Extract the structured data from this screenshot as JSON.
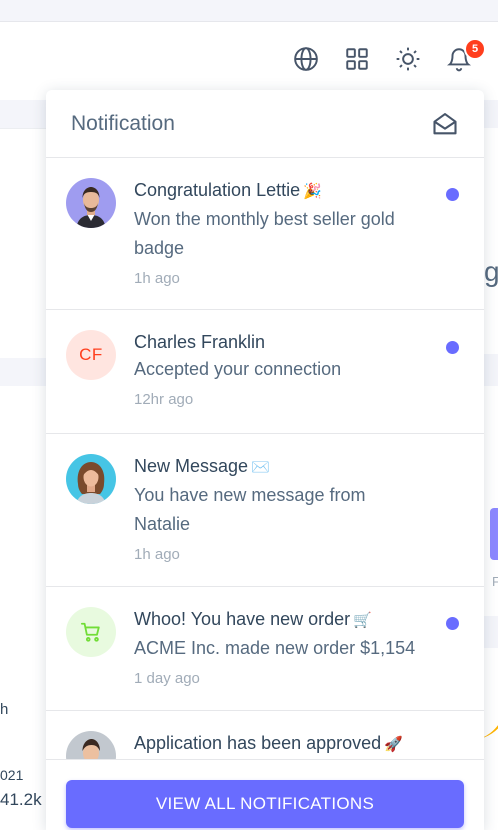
{
  "navbar": {
    "icons": [
      "globe-icon",
      "grid-icon",
      "sun-icon",
      "bell-icon"
    ],
    "notification_count": "5"
  },
  "background": {
    "left_text_1": "h",
    "left_text_2": "021",
    "left_text_3": "41.2k",
    "right_text_1": "g",
    "right_text_2": "F"
  },
  "notifications": {
    "title": "Notification",
    "mark_read_icon": "envelope-open-icon",
    "items": [
      {
        "title": "Congratulation Lettie",
        "emoji": "🎉",
        "text": "Won the monthly best seller gold badge",
        "time": "1h ago",
        "avatar": "man-portrait",
        "unread": true
      },
      {
        "title": "Charles Franklin",
        "emoji": "",
        "text": "Accepted your connection",
        "time": "12hr ago",
        "avatar": "initials",
        "initials": "CF",
        "unread": true
      },
      {
        "title": "New Message",
        "emoji": "✉️",
        "text": "You have new message from Natalie",
        "time": "1h ago",
        "avatar": "woman-portrait",
        "unread": false
      },
      {
        "title": "Whoo! You have new order",
        "emoji": "🛒",
        "text": "ACME Inc. made new order $1,154",
        "time": "1 day ago",
        "avatar": "cart-icon",
        "unread": true
      },
      {
        "title": "Application has been approved",
        "emoji": "🚀",
        "text": "",
        "time": "",
        "avatar": "man-portrait-2",
        "unread": false
      }
    ],
    "view_all_label": "VIEW ALL NOTIFICATIONS"
  },
  "colors": {
    "primary": "#696cff",
    "badge": "#ff3e1d",
    "success": "#71dd37",
    "text": "#32475c"
  }
}
